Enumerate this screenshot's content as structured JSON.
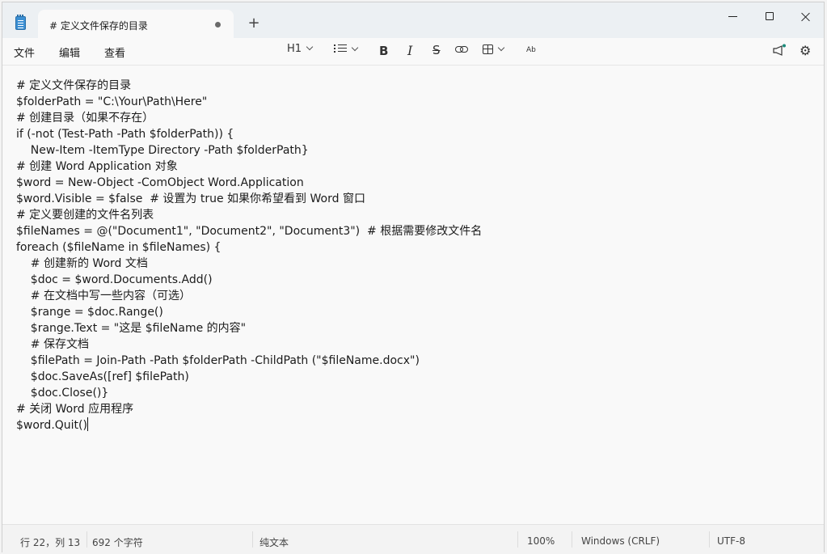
{
  "tab": {
    "title": "# 定义文件保存的目录",
    "new_tab": "+"
  },
  "menu": {
    "file": "文件",
    "edit": "编辑",
    "view": "查看"
  },
  "toolbar": {
    "heading": "H1",
    "bold": "B",
    "italic": "I",
    "strike": "S",
    "spell_top": "A",
    "spell_bottom": "b",
    "settings_glyph": "⚙"
  },
  "editor": {
    "lines": [
      "# 定义文件保存的目录",
      "$folderPath = \"C:\\Your\\Path\\Here\"",
      "# 创建目录（如果不存在）",
      "if (-not (Test-Path -Path $folderPath)) {",
      "    New-Item -ItemType Directory -Path $folderPath}",
      "# 创建 Word Application 对象",
      "$word = New-Object -ComObject Word.Application",
      "$word.Visible = $false  # 设置为 true 如果你希望看到 Word 窗口",
      "# 定义要创建的文件名列表",
      "$fileNames = @(\"Document1\", \"Document2\", \"Document3\")  # 根据需要修改文件名",
      "foreach ($fileName in $fileNames) {",
      "    # 创建新的 Word 文档",
      "    $doc = $word.Documents.Add()",
      "    # 在文档中写一些内容（可选）",
      "    $range = $doc.Range()",
      "    $range.Text = \"这是 $fileName 的内容\"",
      "    # 保存文档",
      "    $filePath = Join-Path -Path $folderPath -ChildPath (\"$fileName.docx\")",
      "    $doc.SaveAs([ref] $filePath)",
      "    $doc.Close()}",
      "# 关闭 Word 应用程序",
      "$word.Quit()"
    ]
  },
  "status": {
    "position": "行 22，列 13",
    "chars": "692 个字符",
    "format": "纯文本",
    "zoom": "100%",
    "line_ending": "Windows (CRLF)",
    "encoding": "UTF-8"
  }
}
